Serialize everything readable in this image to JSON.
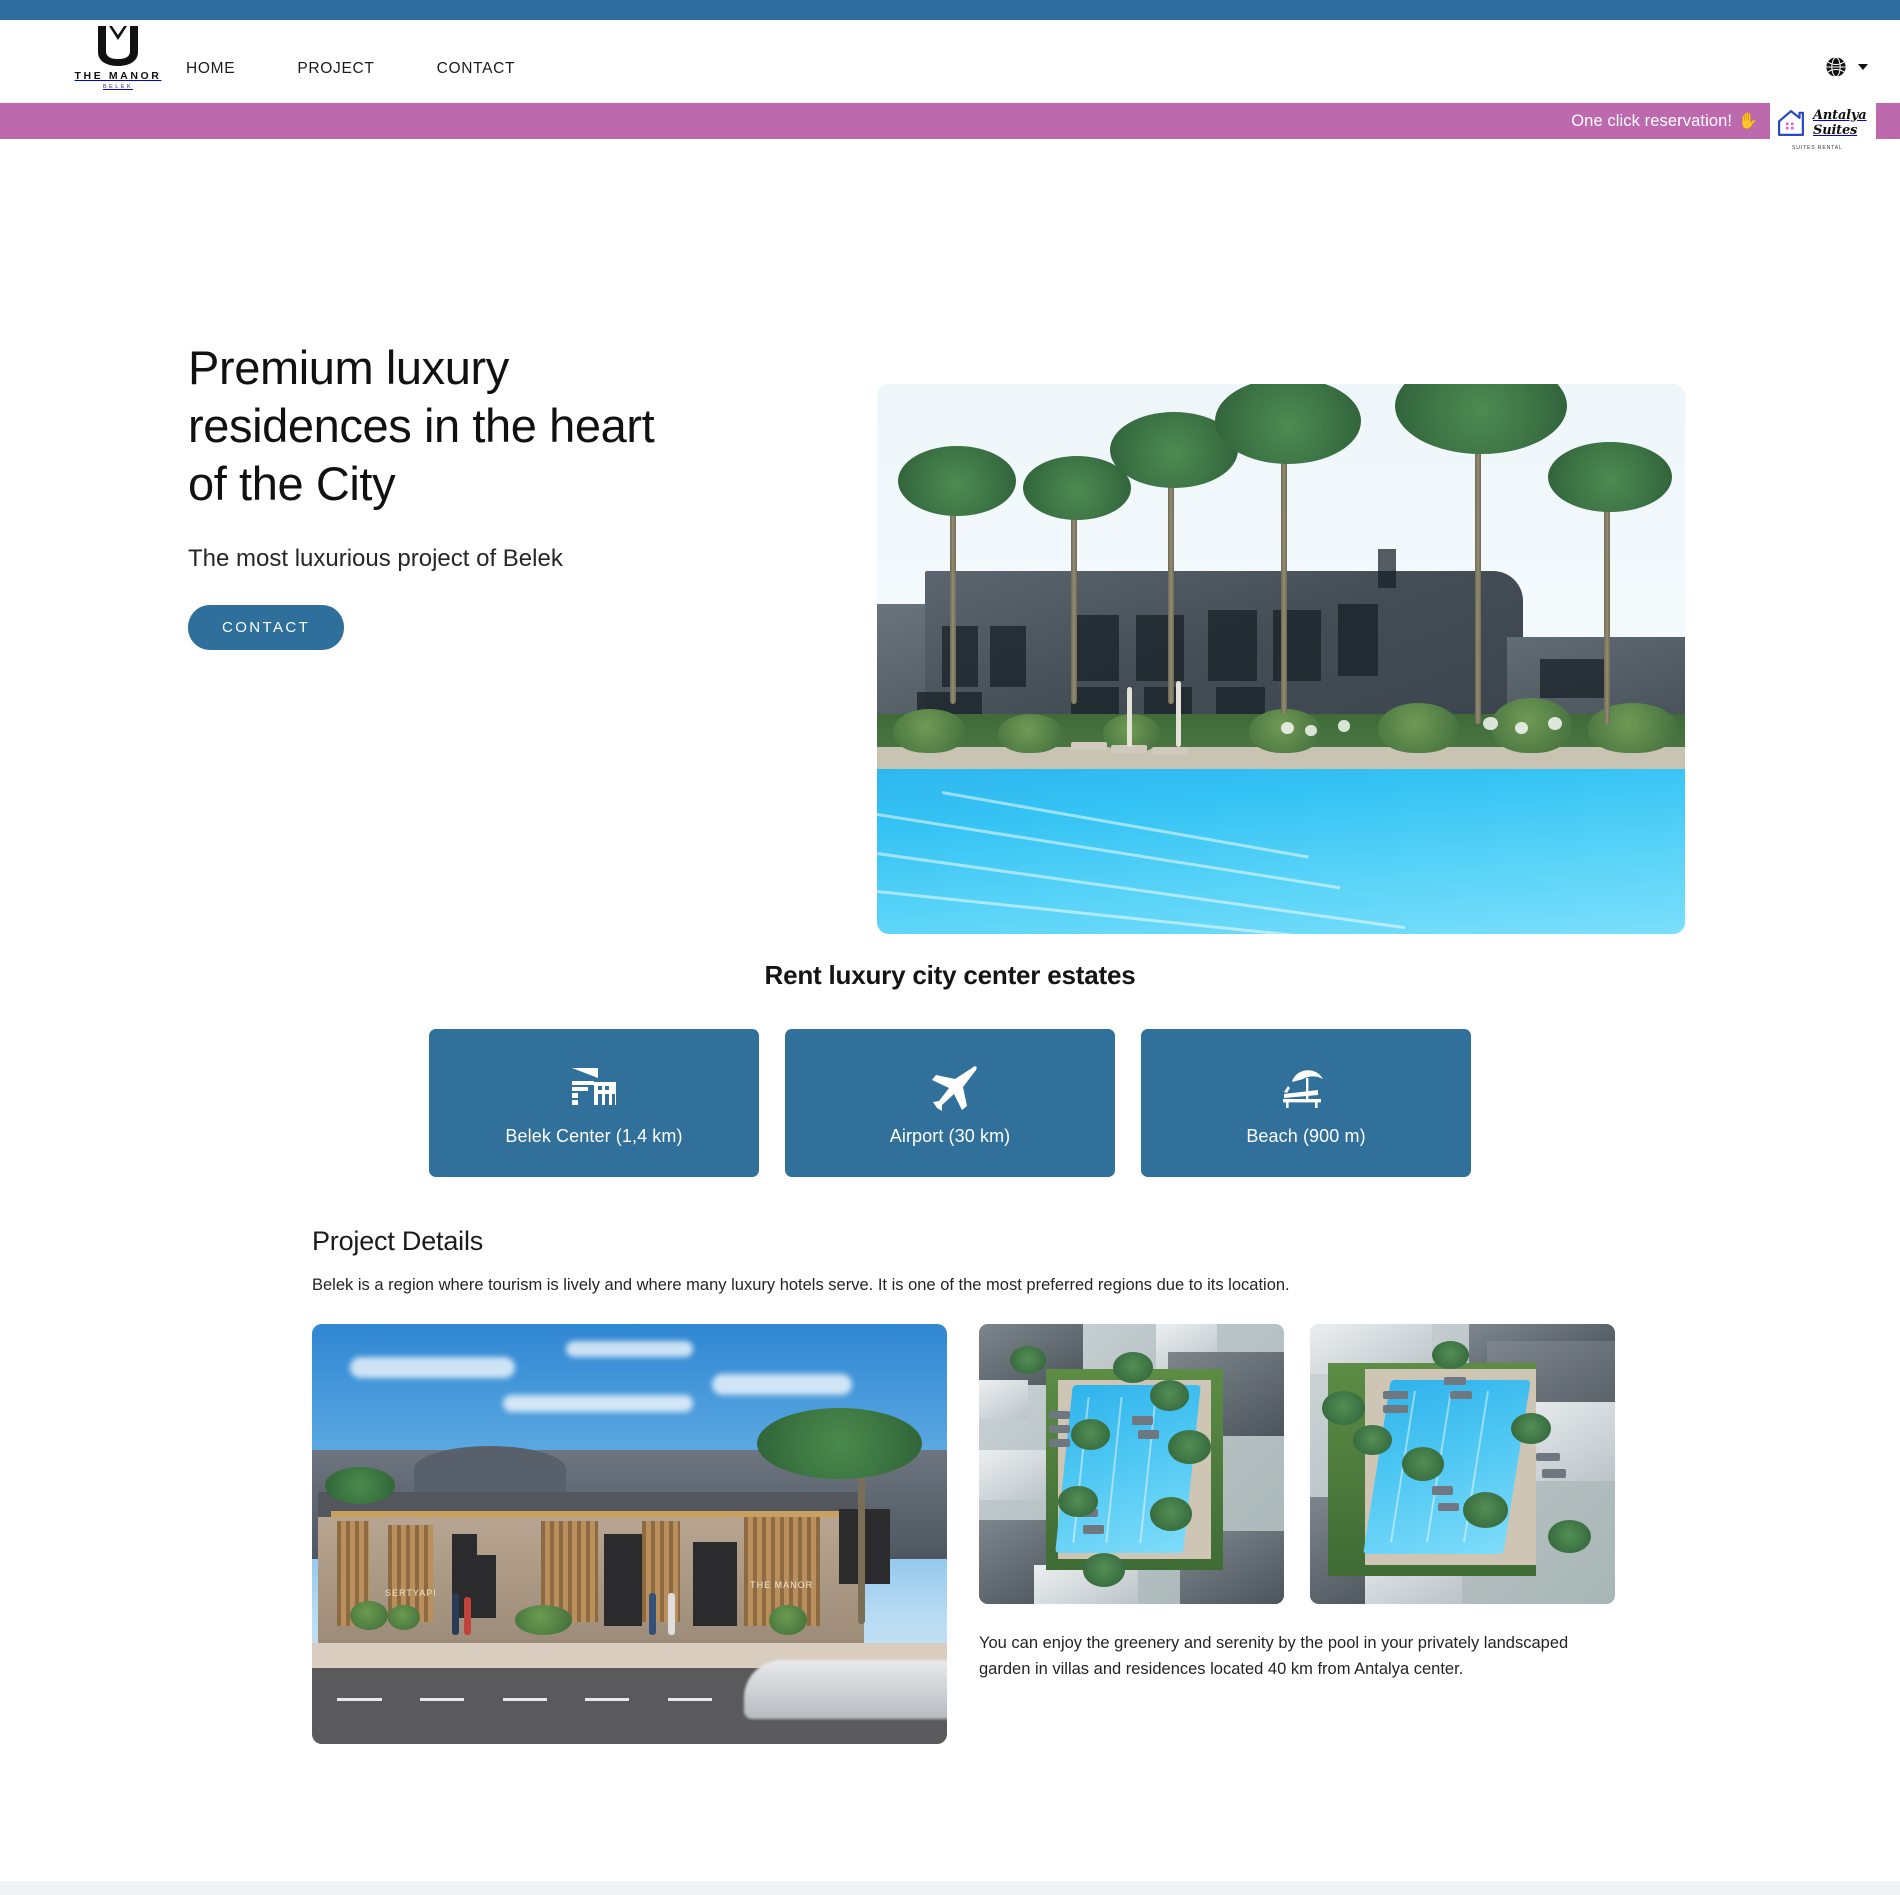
{
  "header": {
    "brand": {
      "mark_icon": "manor-m-monogram",
      "name": "THE MANOR",
      "sub": "BELEK"
    },
    "nav": [
      {
        "label": "HOME"
      },
      {
        "label": "PROJECT"
      },
      {
        "label": "CONTACT"
      }
    ],
    "language_switcher": {
      "icon": "globe-icon",
      "caret_icon": "chevron-down-icon"
    }
  },
  "promo": {
    "text": "One click reservation!",
    "hand_emoji": "✋",
    "background_color": "#bd69ad",
    "partner": {
      "line1": "Antalya",
      "line2": "Suites",
      "tagline": "SUITES RENTAL",
      "house_icon": "house-icon"
    }
  },
  "hero": {
    "title": "Premium luxury residences in the heart of the City",
    "subtitle": "The most luxurious project of Belek",
    "cta_label": "CONTACT",
    "cta_color": "#2f6f9b",
    "image_alt": "luxury-residence-pool-render"
  },
  "estates": {
    "title": "Rent luxury city center estates",
    "card_color": "#30709b",
    "cards": [
      {
        "icon": "city-buildings-icon",
        "label": "Belek Center (1,4 km)"
      },
      {
        "icon": "airplane-icon",
        "label": "Airport (30 km)"
      },
      {
        "icon": "beach-umbrella-lounger-icon",
        "label": "Beach (900 m)"
      }
    ]
  },
  "details": {
    "title": "Project Details",
    "lead": "Belek is a region where tourism is lively and where many luxury hotels serve. It is one of the most preferred regions due to its location.",
    "caption": "You can enjoy the greenery and serenity by the pool in your privately landscaped garden in villas and residences located 40 km from Antalya center.",
    "gallery": [
      {
        "alt": "street-view-entrance-render",
        "sign_left": "SERTYAPI",
        "sign_right": "THE MANOR"
      },
      {
        "alt": "aerial-pool-view-1"
      },
      {
        "alt": "aerial-pool-view-2"
      }
    ]
  },
  "chrome": {
    "top_bar_color": "#2e6e9e"
  }
}
